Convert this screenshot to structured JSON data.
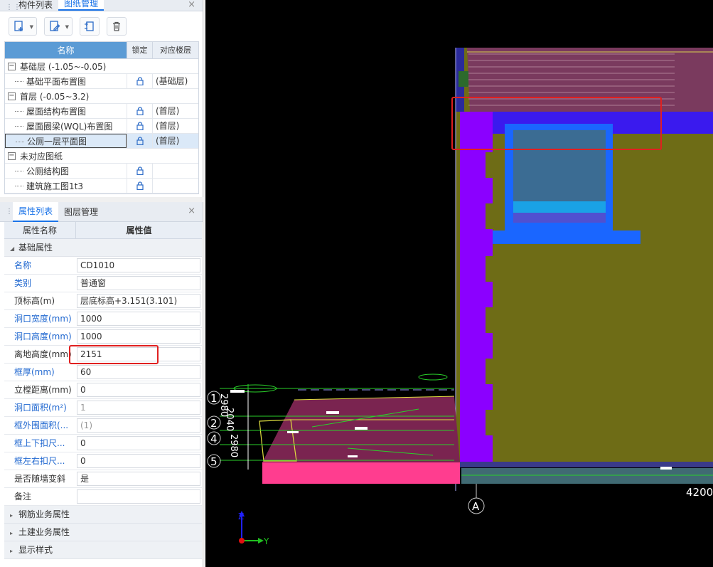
{
  "top_panel": {
    "tabs": [
      "构件列表",
      "图纸管理"
    ],
    "active_tab": "图纸管理",
    "close": "×",
    "columns": [
      "名称",
      "锁定",
      "对应楼层"
    ],
    "groups": [
      {
        "label": "基础层 (-1.05~-0.05)",
        "toggle": "−",
        "items": [
          {
            "name": "基础平面布置图",
            "floor": "(基础层)"
          }
        ]
      },
      {
        "label": "首层 (-0.05~3.2)",
        "toggle": "−",
        "items": [
          {
            "name": "屋面结构布置图",
            "floor": "(首层)"
          },
          {
            "name": "屋面圈梁(WQL)布置图",
            "floor": "(首层)"
          },
          {
            "name": "公厕一层平面图",
            "floor": "(首层)"
          }
        ]
      },
      {
        "label": "未对应图纸",
        "toggle": "−",
        "items": [
          {
            "name": "公厕结构图",
            "floor": ""
          },
          {
            "name": "建筑施工图1t3",
            "floor": ""
          }
        ]
      }
    ]
  },
  "bottom_panel": {
    "tabs": [
      "属性列表",
      "图层管理"
    ],
    "active_tab": "属性列表",
    "close": "×",
    "columns": [
      "属性名称",
      "属性值"
    ],
    "section_basic": "基础属性",
    "props": [
      {
        "k": "名称",
        "v": "CD1010"
      },
      {
        "k": "类别",
        "v": "普通窗"
      },
      {
        "k": "顶标高(m)",
        "v": "层底标高+3.151(3.101)"
      },
      {
        "k": "洞口宽度(mm)",
        "v": "1000"
      },
      {
        "k": "洞口高度(mm)",
        "v": "1000"
      },
      {
        "k": "离地高度(mm)",
        "v": "2151"
      },
      {
        "k": "框厚(mm)",
        "v": "60"
      },
      {
        "k": "立樘距离(mm)",
        "v": "0"
      },
      {
        "k": "洞口面积(m²)",
        "v": "1"
      },
      {
        "k": "框外围面积(...",
        "v": "(1)"
      },
      {
        "k": "框上下扣尺...",
        "v": "0"
      },
      {
        "k": "框左右扣尺...",
        "v": "0"
      },
      {
        "k": "是否随墙变斜",
        "v": "是"
      },
      {
        "k": "备注",
        "v": ""
      }
    ],
    "sections_collapsed": [
      "钢筋业务属性",
      "土建业务属性",
      "显示样式"
    ]
  },
  "canvas": {
    "axis_labels": [
      "1",
      "2",
      "4",
      "5"
    ],
    "vertical_dims": [
      "2980",
      "2040",
      "2980"
    ],
    "axis_bottom": "A",
    "dim_right": "4200",
    "coord": {
      "z": "Z",
      "y": "Y"
    }
  },
  "colors": {
    "accent": "#1a73e8",
    "highlight_red": "#e02020",
    "wall_olive": "#6e6c16",
    "wall_purple": "#8b00ff",
    "window_blue": "#1a66ff"
  }
}
